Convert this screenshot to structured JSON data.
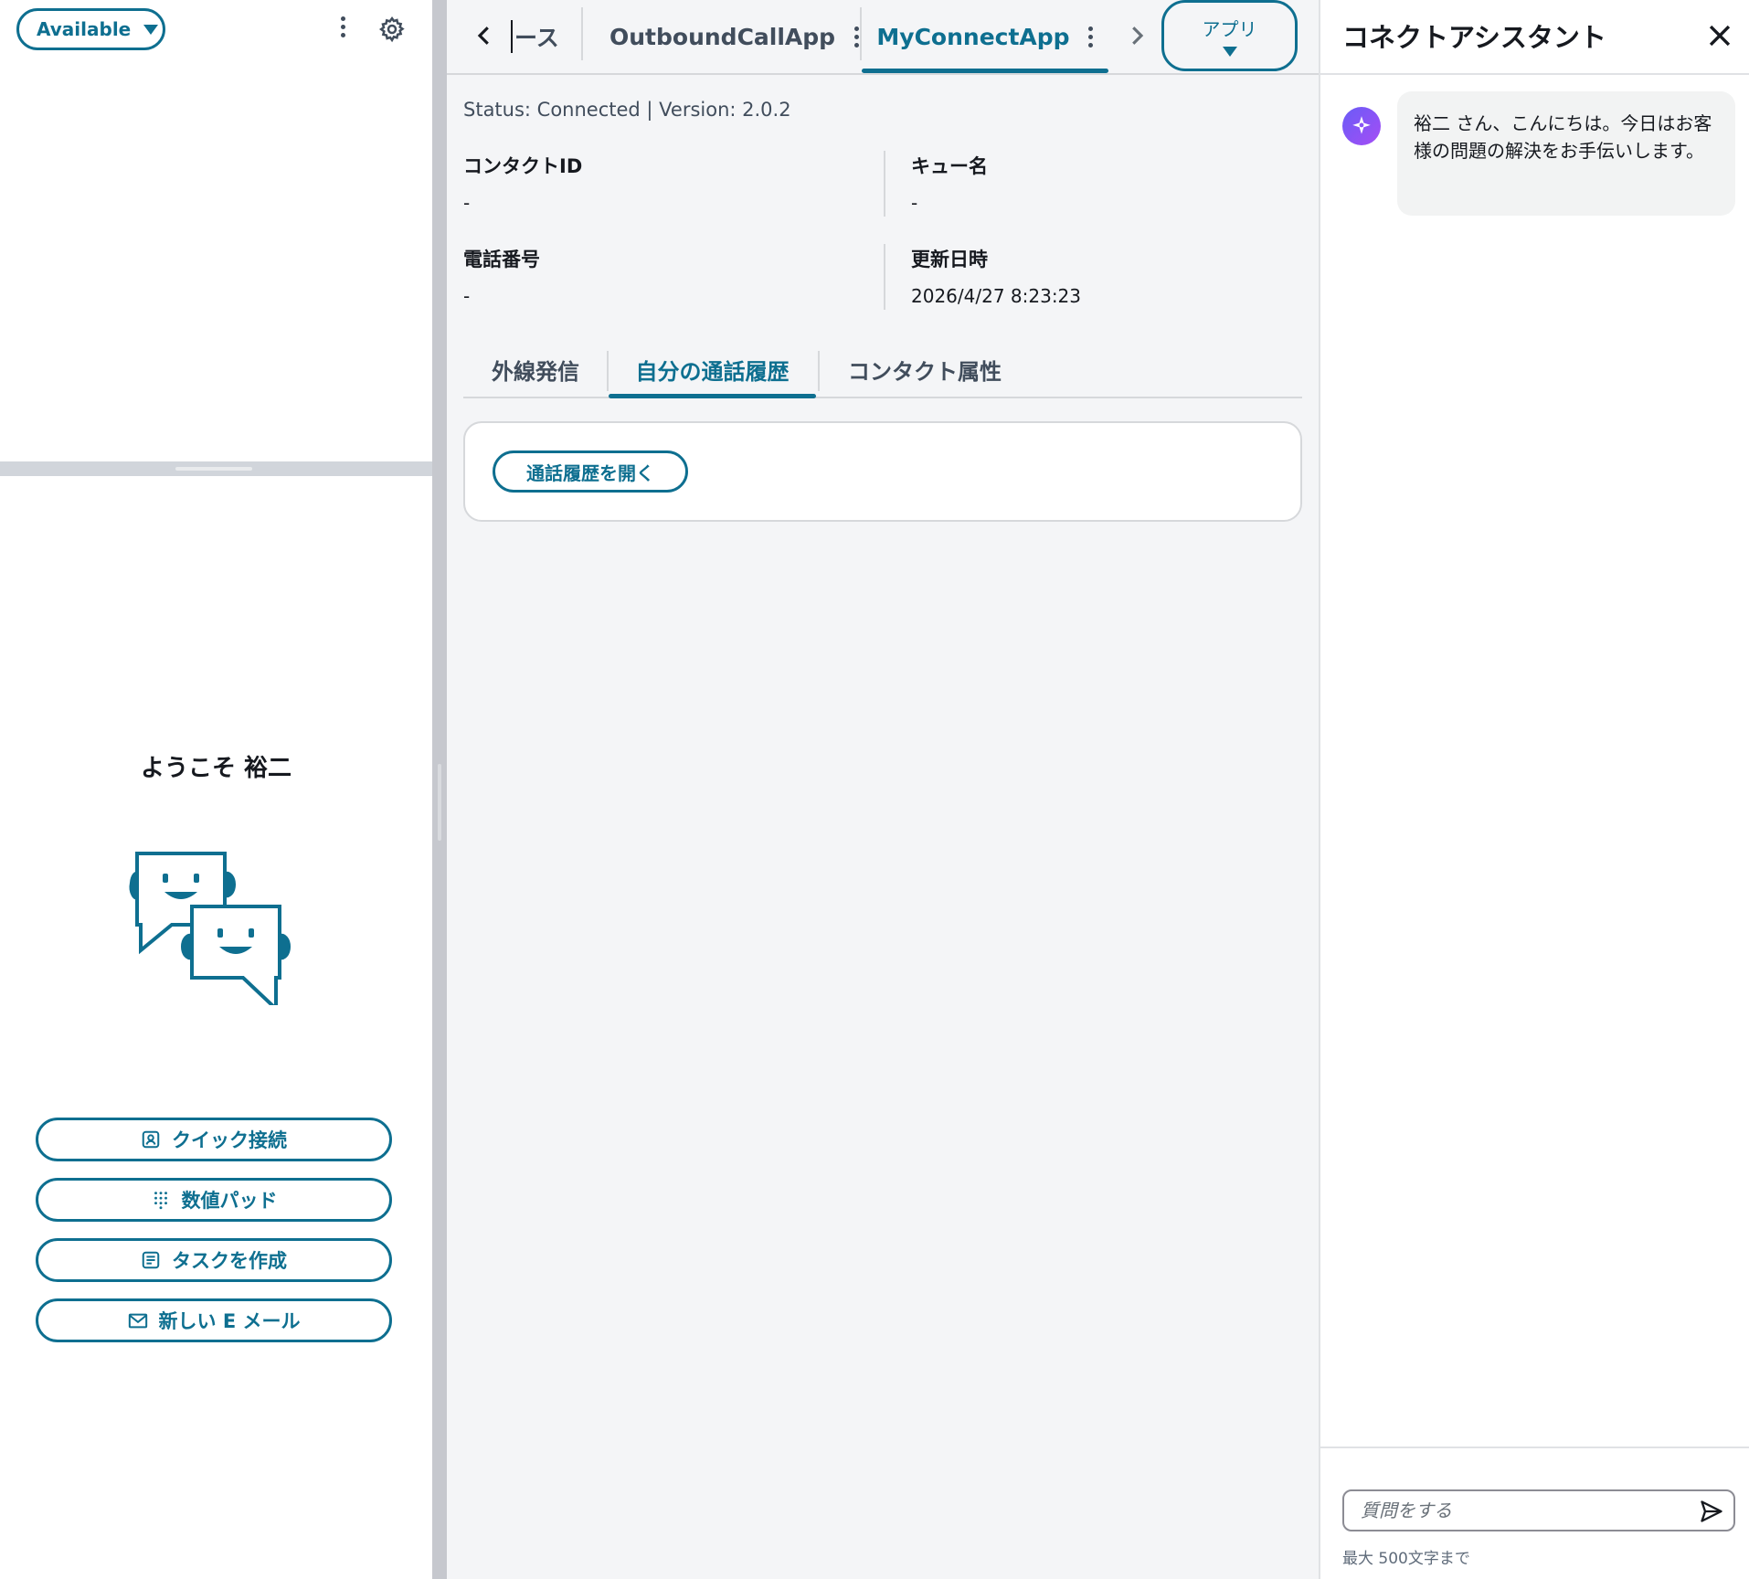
{
  "ccp": {
    "status": "Available",
    "welcome": "ようこそ 裕二",
    "buttons": {
      "quick_connect": "クイック接続",
      "number_pad": "数値パッド",
      "create_task": "タスクを作成",
      "new_email": "新しい E メール"
    }
  },
  "app": {
    "tabs": [
      {
        "label": "ース"
      },
      {
        "label": "OutboundCallApp"
      },
      {
        "label": "MyConnectApp"
      }
    ],
    "apps_menu": "アプリ",
    "status_line": "Status: Connected | Version: 2.0.2",
    "fields": {
      "contact_id": {
        "label": "コンタクトID",
        "value": "-"
      },
      "queue_name": {
        "label": "キュー名",
        "value": "-"
      },
      "phone_number": {
        "label": "電話番号",
        "value": "-"
      },
      "updated_at": {
        "label": "更新日時",
        "value": "2026/4/27 8:23:23"
      }
    },
    "subtabs": [
      "外線発信",
      "自分の通話履歴",
      "コンタクト属性"
    ],
    "open_history_button": "通話履歴を開く"
  },
  "assistant": {
    "title": "コネクトアシスタント",
    "greeting": "裕二 さん、こんにちは。今日はお客様の問題の解決をお手伝いします。",
    "input_placeholder": "質問をする",
    "char_limit": "最大 500文字まで"
  },
  "colors": {
    "accent": "#0e6f90",
    "assistant_gradient_start": "#6a5cf6",
    "assistant_gradient_end": "#a54df5"
  },
  "icons": [
    "gear-icon",
    "chevron-left-icon",
    "chevron-right-icon",
    "close-icon",
    "sparkle-icon",
    "send-icon",
    "contact-card-icon",
    "dialpad-icon",
    "task-icon",
    "mail-icon"
  ]
}
